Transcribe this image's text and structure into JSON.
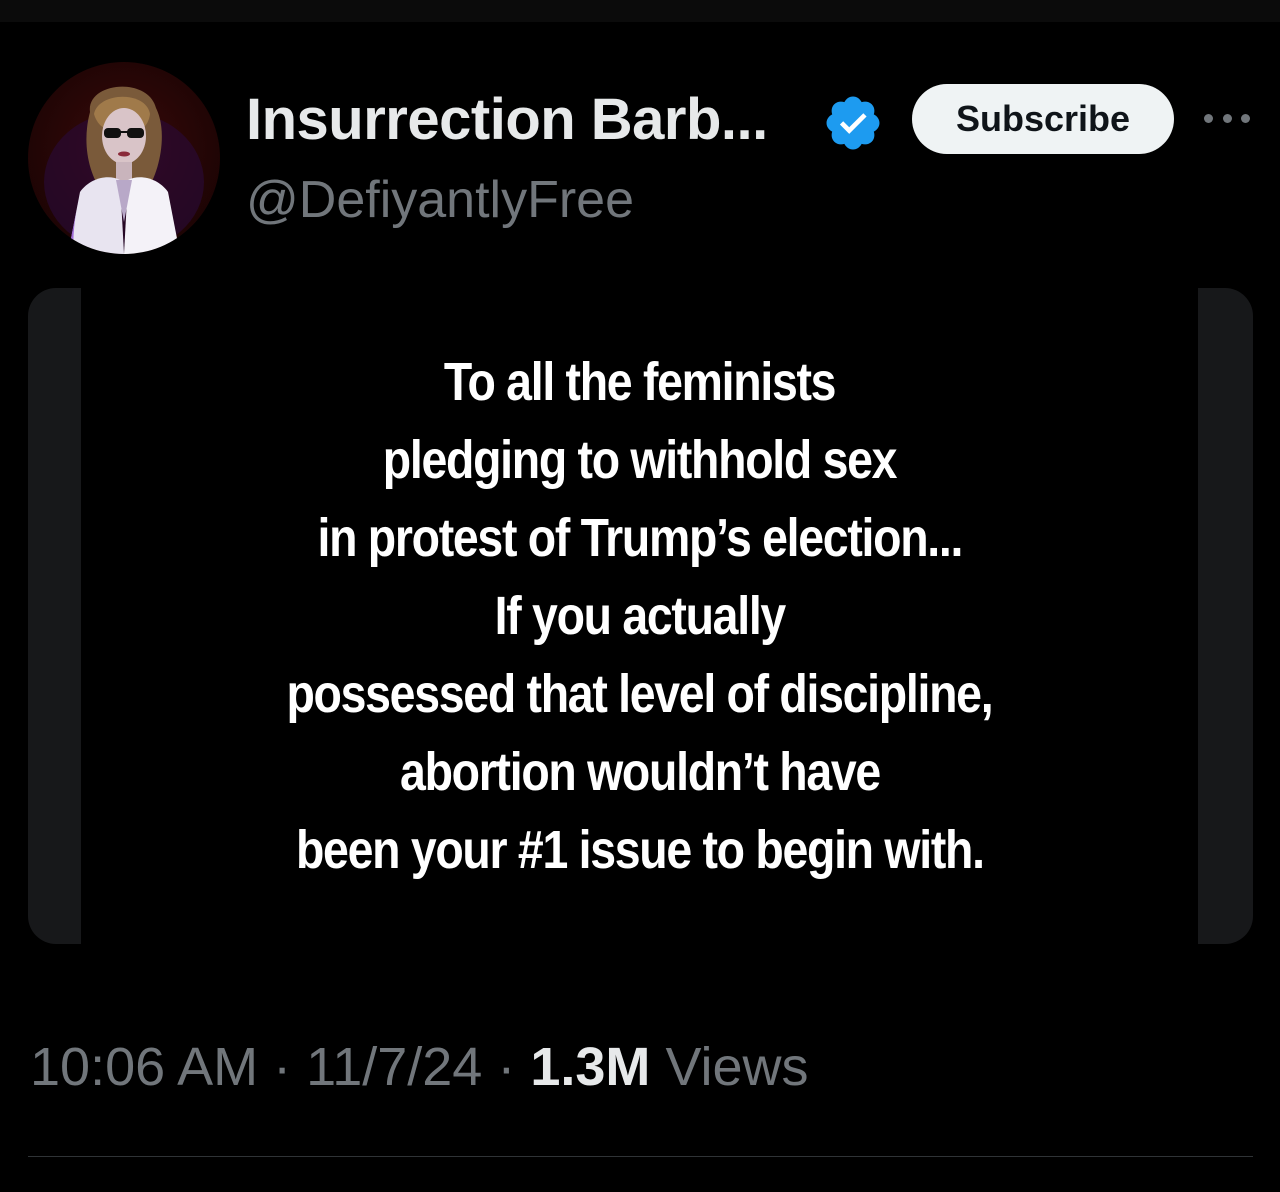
{
  "author": {
    "display_name": "Insurrection Barb...",
    "handle": "@DefiyantlyFree",
    "avatar_icon": "profile-photo",
    "verified": true,
    "verified_color": "#1d9bf0"
  },
  "actions": {
    "subscribe_label": "Subscribe",
    "more_icon": "more-horizontal-icon"
  },
  "post": {
    "image_lines": [
      "To all the feminists",
      "pledging to withhold sex",
      "in protest of Trump’s election...",
      "If you actually",
      "possessed that level of discipline,",
      "abortion wouldn’t have",
      "been your #1 issue to begin with."
    ]
  },
  "meta": {
    "time": "10:06 AM",
    "separator": "·",
    "date": "11/7/24",
    "views_count": "1.3M",
    "views_label": "Views"
  }
}
